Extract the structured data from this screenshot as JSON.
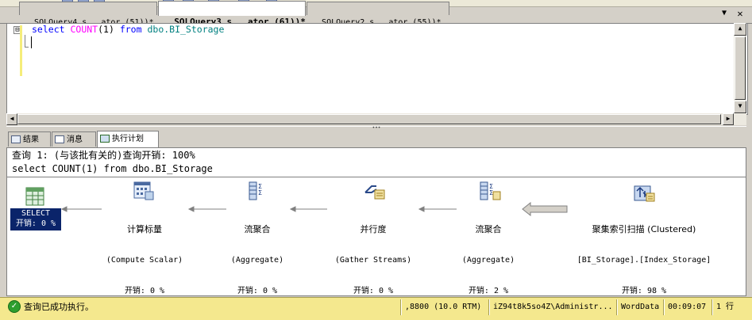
{
  "document_tabs": [
    {
      "label": "SQLQuery4.s...ator (51))*"
    },
    {
      "label": "SQLQuery3.s...ator (61))*"
    },
    {
      "label": "SQLQuery2.s...ator (55))*"
    }
  ],
  "tab_controls": {
    "dropdown": "▼",
    "close": "✕"
  },
  "editor": {
    "code": {
      "kw1": "select",
      "fn": "COUNT",
      "args": "(1)",
      "kw2": "from",
      "obj": "dbo.BI_Storage"
    },
    "collapse_symbol": "⊟"
  },
  "results": {
    "tabs": [
      {
        "label": "结果"
      },
      {
        "label": "消息"
      },
      {
        "label": "执行计划"
      }
    ],
    "active_tab": "执行计划"
  },
  "plan": {
    "query_info": "查询 1: (与该批有关的)查询开销: 100%",
    "query_sql": "select COUNT(1) from dbo.BI_Storage",
    "operators": [
      {
        "name": "SELECT",
        "cost": "开销: 0 %"
      },
      {
        "name": "计算标量",
        "sub": "(Compute Scalar)",
        "cost": "开销: 0 %"
      },
      {
        "name": "流聚合",
        "sub": "(Aggregate)",
        "cost": "开销: 0 %"
      },
      {
        "name": "并行度",
        "sub": "(Gather Streams)",
        "cost": "开销: 0 %"
      },
      {
        "name": "流聚合",
        "sub": "(Aggregate)",
        "cost": "开销: 2 %"
      },
      {
        "name": "聚集索引扫描 (Clustered)",
        "sub": "[BI_Storage].[Index_Storage]",
        "cost": "开销: 98 %"
      }
    ]
  },
  "status": {
    "message": "查询已成功执行。",
    "server": ",8800 (10.0 RTM)",
    "user": "iZ94t8k5so4Z\\Administr...",
    "database": "WordData",
    "elapsed": "00:09:07",
    "rows": "1 行"
  },
  "colors": {
    "status_bar": "#f4e88e",
    "selected_operator": "#0a246a",
    "keyword": "#0000ff",
    "function": "#ff00ff",
    "object": "#008080"
  }
}
